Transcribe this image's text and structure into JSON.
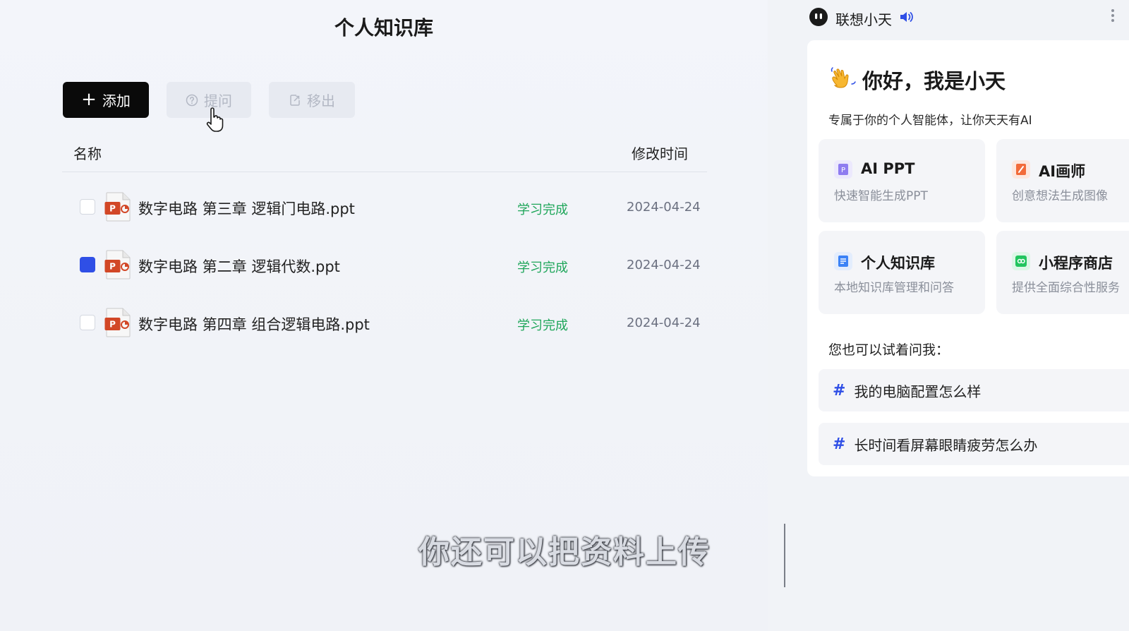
{
  "page": {
    "title": "个人知识库"
  },
  "toolbar": {
    "add_label": "添加",
    "ask_label": "提问",
    "remove_label": "移出"
  },
  "table": {
    "col_name": "名称",
    "col_time": "修改时间",
    "rows": [
      {
        "name": "数字电路 第三章 逻辑门电路.ppt",
        "status": "学习完成",
        "date": "2024-04-24",
        "checked": false
      },
      {
        "name": "数字电路 第二章 逻辑代数.ppt",
        "status": "学习完成",
        "date": "2024-04-24",
        "checked": true
      },
      {
        "name": "数字电路 第四章 组合逻辑电路.ppt",
        "status": "学习完成",
        "date": "2024-04-24",
        "checked": false
      }
    ]
  },
  "caption": "你还可以把资料上传",
  "assistant": {
    "name": "联想小天",
    "greeting": "你好，我是小天",
    "description": "专属于你的个人智能体，让你天天有AI",
    "features": [
      {
        "title": "AI PPT",
        "desc": "快速智能生成PPT",
        "color": "#8e7cf0"
      },
      {
        "title": "AI画师",
        "desc": "创意想法生成图像",
        "color": "#f26b3a"
      },
      {
        "title": "个人知识库",
        "desc": "本地知识库管理和问答",
        "color": "#3b82f6"
      },
      {
        "title": "小程序商店",
        "desc": "提供全面综合性服务",
        "color": "#22c55e"
      }
    ],
    "try_label": "您也可以试着问我：",
    "suggestions": [
      "我的电脑配置怎么样",
      "长时间看屏幕眼睛疲劳怎么办"
    ]
  },
  "colors": {
    "accent": "#2f4fe6",
    "status_green": "#1fa65a"
  }
}
